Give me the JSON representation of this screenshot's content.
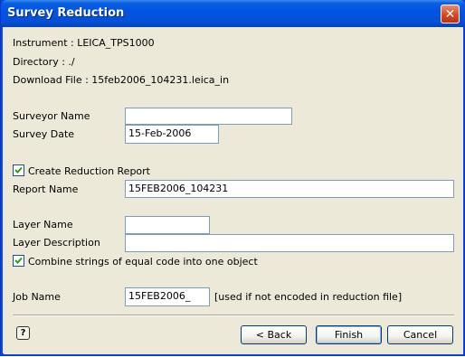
{
  "window": {
    "title": "Survey Reduction"
  },
  "info": {
    "instrument": "Instrument   : LEICA_TPS1000",
    "directory": "Directory      : ./",
    "download_file": "Download File : 15feb2006_104231.leica_in"
  },
  "form": {
    "surveyor_name_label": "Surveyor Name",
    "surveyor_name_value": "",
    "survey_date_label": "Survey Date",
    "survey_date_value": "15-Feb-2006",
    "create_report_label": "Create Reduction Report",
    "create_report_checked": true,
    "report_name_label": "Report Name",
    "report_name_value": "15FEB2006_104231",
    "layer_name_label": "Layer Name",
    "layer_name_value": "",
    "layer_description_label": "Layer Description",
    "layer_description_value": "",
    "combine_strings_label": "Combine strings of equal code into one object",
    "combine_strings_checked": true,
    "job_name_label": "Job Name",
    "job_name_value": "15FEB2006_",
    "job_name_note": "[used if not encoded in reduction file]"
  },
  "buttons": {
    "help_icon": "question-help-icon",
    "back": "< Back",
    "finish": "Finish",
    "cancel": "Cancel"
  }
}
